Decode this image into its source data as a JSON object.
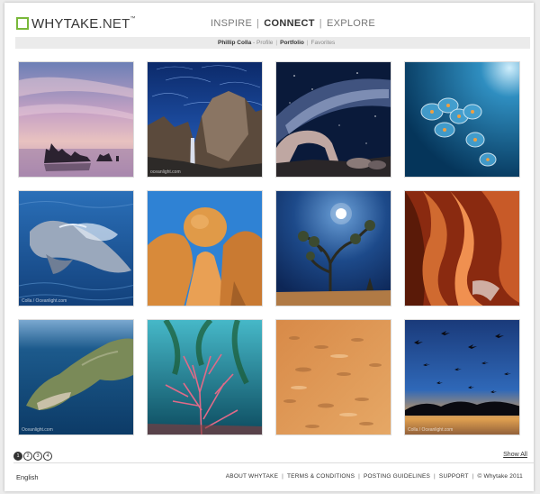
{
  "brand": {
    "name_main": "WHYTAKE",
    "name_tld": ".NET",
    "trademark": "™",
    "accent": "#79b83a"
  },
  "topnav": [
    {
      "label": "INSPIRE",
      "active": false
    },
    {
      "label": "CONNECT",
      "active": true
    },
    {
      "label": "EXPLORE",
      "active": false
    }
  ],
  "subnav": {
    "user": "Phillip Colla",
    "separator_dash": " - ",
    "items": [
      "Profile",
      "Portfolio",
      "Favorites"
    ],
    "active": "Portfolio"
  },
  "photos": [
    {
      "name": "photo-mono-lake-tufa",
      "caption": ""
    },
    {
      "name": "photo-yosemite-falls-star-trails",
      "caption": "oceanlight.com"
    },
    {
      "name": "photo-milky-way-arch",
      "caption": ""
    },
    {
      "name": "photo-salp-chain",
      "caption": ""
    },
    {
      "name": "photo-dolphin",
      "caption": "Colla / Oceanlight.com"
    },
    {
      "name": "photo-balanced-boulder",
      "caption": ""
    },
    {
      "name": "photo-joshua-tree-moon",
      "caption": ""
    },
    {
      "name": "photo-antelope-canyon",
      "caption": ""
    },
    {
      "name": "photo-catalina-island",
      "caption": "Oceanlight.com"
    },
    {
      "name": "photo-sea-fan-kelp",
      "caption": ""
    },
    {
      "name": "photo-sand-dunes-abstract",
      "caption": ""
    },
    {
      "name": "photo-snow-geese-sunrise",
      "caption": "Colla / Oceanlight.com"
    }
  ],
  "pagination": {
    "pages": [
      "1",
      "2",
      "3",
      "4"
    ],
    "current": "1",
    "show_all": "Show All"
  },
  "footer": {
    "language": "English",
    "links": [
      "ABOUT WHYTAKE",
      "TERMS & CONDITIONS",
      "POSTING GUIDELINES",
      "SUPPORT"
    ],
    "copyright": "© Whytake 2011",
    "separator": "|"
  }
}
